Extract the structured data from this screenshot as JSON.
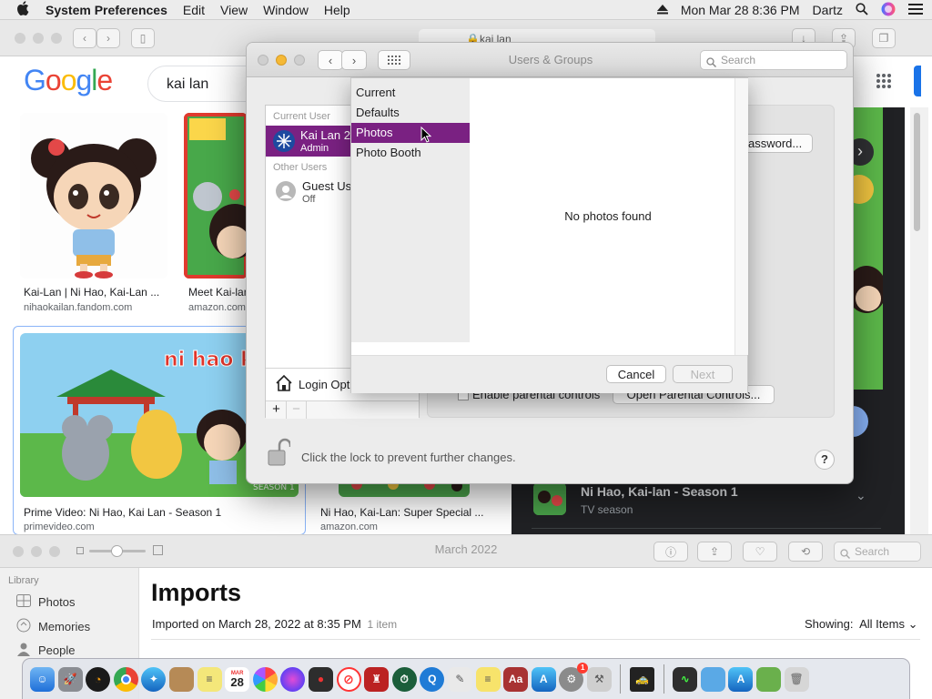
{
  "menubar": {
    "app": "System Preferences",
    "items": [
      "Edit",
      "View",
      "Window",
      "Help"
    ],
    "clock": "Mon Mar 28  8:36 PM",
    "user": "Dartz"
  },
  "safari": {
    "address": "kai lan",
    "search_query": "kai lan",
    "results_row1": [
      {
        "caption": "Kai-Lan | Ni Hao, Kai-Lan ...",
        "source": "nihaokailan.fandom.com"
      },
      {
        "caption": "Meet Kai-lan",
        "source": "amazon.com"
      }
    ],
    "results_row2": [
      {
        "caption": "Prime Video: Ni Hao, Kai Lan - Season 1",
        "source": "primevideo.com",
        "image_text": "ni hao kai-lan",
        "badge": "SEASON 1"
      },
      {
        "caption": "Ni Hao, Kai-Lan: Super Special ...",
        "source": "amazon.com"
      }
    ],
    "knowledge_panel": {
      "title": "Ni Hao, Kai-lan - Season 1",
      "subtitle": "TV season"
    }
  },
  "users_groups": {
    "title": "Users & Groups",
    "search_placeholder": "Search",
    "current_user_header": "Current User",
    "current_user_name": "Kai Lan 2",
    "current_user_role": "Admin",
    "other_users_header": "Other Users",
    "guest_name": "Guest Us",
    "guest_status": "Off",
    "login_options": "Login Opt",
    "add_label": "+",
    "remove_label": "−",
    "password_button": "assword...",
    "parental_checkbox": "Enable parental controls",
    "parental_button": "Open Parental Controls...",
    "lock_text": "Click the lock to prevent further changes.",
    "help": "?"
  },
  "sheet": {
    "sources": [
      "Current",
      "Defaults",
      "Photos",
      "Photo Booth"
    ],
    "selected_index": 2,
    "empty_message": "No photos found",
    "cancel": "Cancel",
    "next": "Next"
  },
  "photos": {
    "window_title": "March 2022",
    "search_placeholder": "Search",
    "library_header": "Library",
    "sidebar": [
      "Photos",
      "Memories",
      "People"
    ],
    "heading": "Imports",
    "imported_label": "Imported on March 28, 2022 at 8:35 PM",
    "item_count": "1 item",
    "showing_label": "Showing:",
    "showing_value": "All Items"
  },
  "dock": {
    "calendar_month": "MAR",
    "calendar_day": "28",
    "settings_badge": "1"
  },
  "colors": {
    "selection": "#7a2182",
    "google_blue": "#4285f4",
    "google_red": "#ea4335",
    "google_yellow": "#fbbc05",
    "google_green": "#34a853"
  }
}
